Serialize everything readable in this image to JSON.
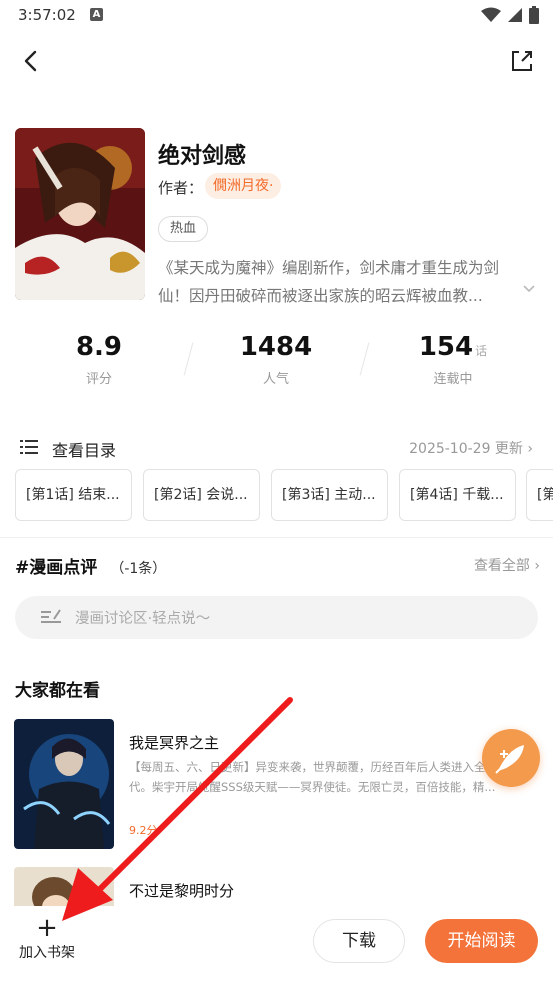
{
  "status_bar": {
    "time": "3:57:02",
    "notification_letter": "A",
    "icons": [
      "wifi-icon",
      "signal-icon",
      "battery-icon"
    ]
  },
  "header": {
    "back_icon": "back-arrow-icon",
    "share_icon": "share-icon"
  },
  "comic": {
    "title": "绝对剑感",
    "author_label": "作者：",
    "author_name": "僩洲月夜·",
    "tag": "热血",
    "description": "《某天成为魔神》编剧新作，剑术庸才重生成为剑仙！因丹田破碎而被逐出家族的昭云辉被血教..."
  },
  "stats": [
    {
      "value": "8.9",
      "unit": "",
      "label": "评分"
    },
    {
      "value": "1484",
      "unit": "",
      "label": "人气"
    },
    {
      "value": "154",
      "unit": "话",
      "label": "连载中"
    }
  ],
  "catalog": {
    "label": "查看目录",
    "update": "2025-10-29 更新"
  },
  "chapters": [
    {
      "label": "[第1话] 结束..."
    },
    {
      "label": "[第2话] 会说..."
    },
    {
      "label": "[第3话] 主动..."
    },
    {
      "label": "[第4话] 千载..."
    },
    {
      "label": "[第"
    }
  ],
  "reviews": {
    "title": "#漫画点评",
    "count": "（-1条）",
    "view_all": "查看全部",
    "input_placeholder": "漫画讨论区·轻点说～"
  },
  "recommend": {
    "title": "大家都在看",
    "items": [
      {
        "title": "我是冥界之主",
        "desc": "【每周五、六、日更新】异变来袭，世界颠覆，历经百年后人类进入全民职时代。柴宇开局觉醒SSS级天赋——冥界使徒。无限亡灵，百倍技能，精...",
        "score": "9.2分"
      },
      {
        "title": "不过是黎明时分",
        "desc": "",
        "score": ""
      }
    ]
  },
  "bottom_bar": {
    "shelf_plus": "+",
    "shelf_label": "加入书架",
    "download": "下载",
    "read": "开始阅读"
  },
  "colors": {
    "accent": "#f4733a",
    "author_chip_bg": "#fdeee3",
    "annotation_arrow": "#ee1c1c"
  }
}
